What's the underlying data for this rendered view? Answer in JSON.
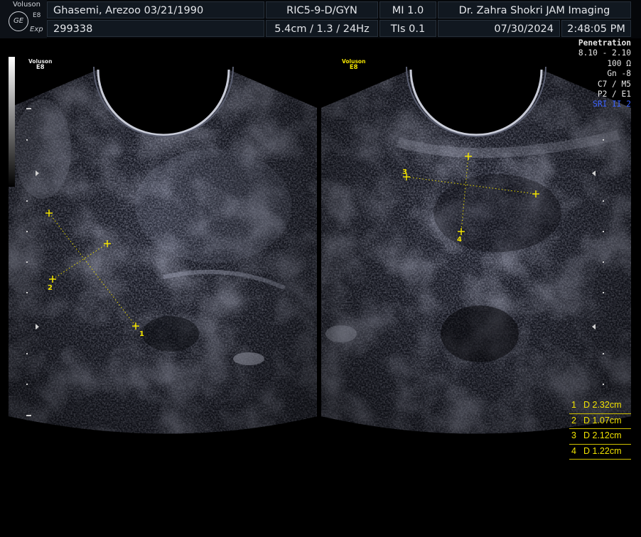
{
  "system": {
    "brand": "Voluson",
    "model": "E8",
    "logo_text": "GE",
    "mode": "Exp"
  },
  "patient": {
    "name_dob": "Ghasemi, Arezoo  03/21/1990",
    "id": "299338"
  },
  "probe": {
    "preset": "RIC5-9-D/GYN",
    "depth_info": "5.4cm / 1.3 / 24Hz"
  },
  "indices": {
    "mi": "MI  1.0",
    "tis": "TIs  0.1"
  },
  "institution": "Dr. Zahra Shokri JAM Imaging",
  "date": "07/30/2024",
  "time": "2:48:05 PM",
  "params": [
    "Penetration",
    "8.10 - 2.10",
    "100 Ω",
    "Gn  -8",
    "C7 / M5",
    "P2 / E1",
    "SRI II 2"
  ],
  "left_image_label": {
    "brand": "Voluson",
    "model": "E8"
  },
  "right_image_label": {
    "brand": "Voluson",
    "model": "E8"
  },
  "caliper_numbers": [
    "1",
    "2",
    "3",
    "4"
  ],
  "measurements": [
    {
      "index": "1",
      "value": "D 2.32cm"
    },
    {
      "index": "2",
      "value": "D 1.07cm"
    },
    {
      "index": "3",
      "value": "D 2.12cm"
    },
    {
      "index": "4",
      "value": "D 1.22cm"
    }
  ],
  "colors": {
    "caliper": "#f2e300",
    "text": "#e8e8e8",
    "sri_highlight": "#3d63ff",
    "left_label": "#e6e6e6",
    "right_label": "#f2e300"
  }
}
